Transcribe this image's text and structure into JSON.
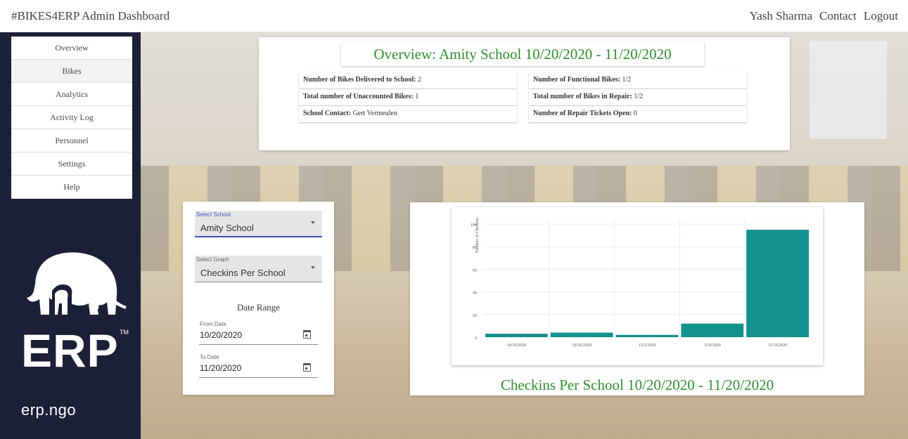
{
  "header": {
    "title": "#BIKES4ERP Admin Dashboard",
    "links": [
      "Yash Sharma",
      "Contact",
      "Logout"
    ]
  },
  "sidebar": {
    "items": [
      {
        "label": "Overview"
      },
      {
        "label": "Bikes"
      },
      {
        "label": "Analytics"
      },
      {
        "label": "Activity Log"
      },
      {
        "label": "Personnel"
      },
      {
        "label": "Settings"
      },
      {
        "label": "Help"
      }
    ],
    "active_index": 1,
    "logo_text": "ERP",
    "logo_tm": "TM",
    "logo_url": "erp.ngo"
  },
  "overview": {
    "title": "Overview: Amity School 10/20/2020 - 11/20/2020",
    "stats": [
      {
        "label": "Number of Bikes Delivered to School:",
        "value": "2"
      },
      {
        "label": "Number of Functional Bikes:",
        "value": "1/2"
      },
      {
        "label": "Total number of Unaccounted Bikes:",
        "value": "1"
      },
      {
        "label": "Total number of Bikes in Repair:",
        "value": "1/2"
      },
      {
        "label": "School Contact:",
        "value": "Gert Vermeulen"
      },
      {
        "label": "Number of Repair Tickets Open:",
        "value": "0"
      }
    ]
  },
  "form": {
    "school_label": "Select School",
    "school_value": "Amity School",
    "graph_label": "Select Graph",
    "graph_value": "Checkins Per School",
    "date_range_title": "Date Range",
    "from_label": "From Date",
    "from_value": "10/20/2020",
    "to_label": "To Date",
    "to_value": "11/20/2020"
  },
  "chart_caption": "Checkins Per School 10/20/2020 - 11/20/2020",
  "colors": {
    "accent_green": "#2f8f2f",
    "bar_teal": "#13918f",
    "sidebar_bg": "#1b2037",
    "focus_blue": "#3f51b5"
  },
  "chart_data": {
    "type": "bar",
    "categories": [
      "10/19/2020",
      "10/26/2020",
      "11/2/2020",
      "11/9/2020",
      "11/16/2020"
    ],
    "values": [
      3,
      4,
      2,
      12,
      95
    ],
    "ylabel": "Number of Checkins",
    "yticks": [
      0,
      20,
      40,
      60,
      80,
      100
    ],
    "ylim": [
      0,
      100
    ],
    "grid": true
  }
}
